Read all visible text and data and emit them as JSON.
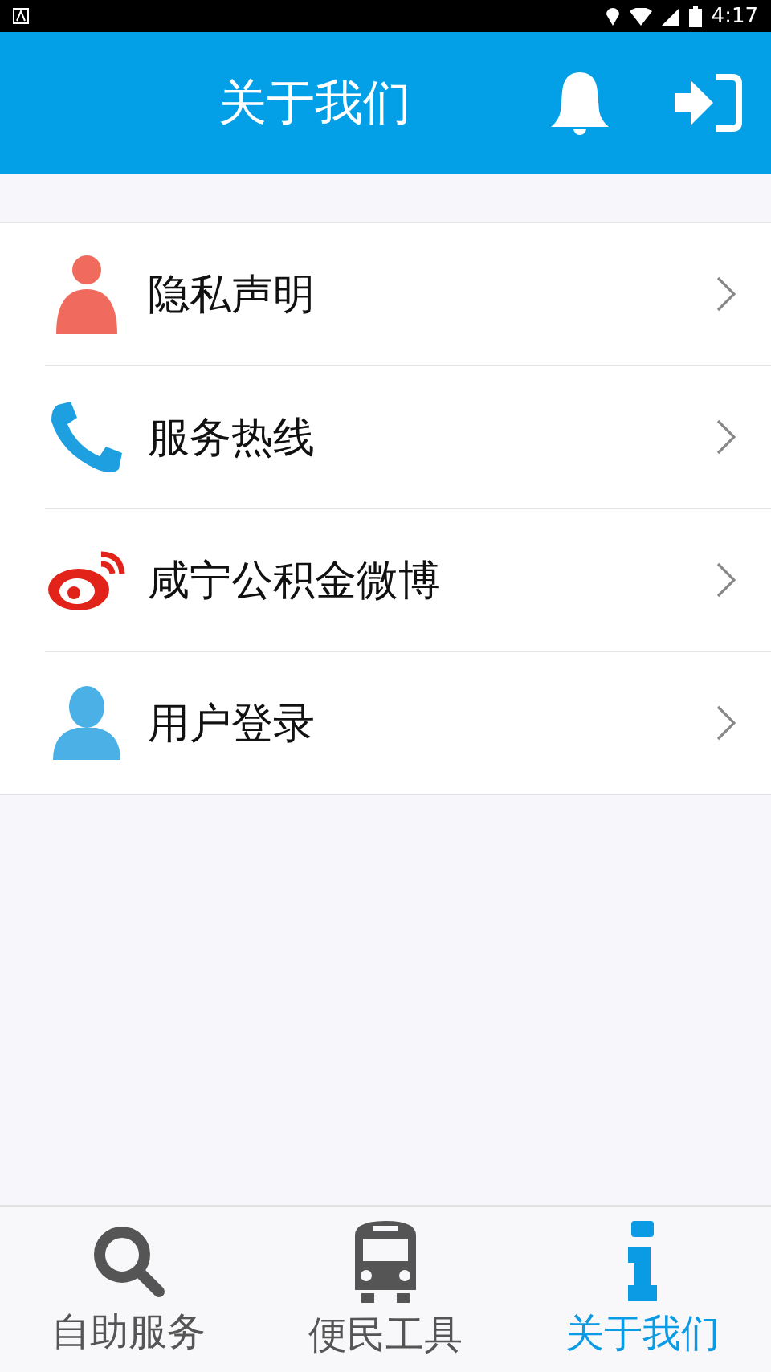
{
  "status_bar": {
    "time": "4:17"
  },
  "header": {
    "title": "关于我们"
  },
  "menu": [
    {
      "label": "隐私声明",
      "kind": "privacy"
    },
    {
      "label": "服务热线",
      "kind": "phone"
    },
    {
      "label": "咸宁公积金微博",
      "kind": "weibo"
    },
    {
      "label": "用户登录",
      "kind": "user"
    }
  ],
  "tabs": [
    {
      "label": "自助服务",
      "kind": "search",
      "selected": false
    },
    {
      "label": "便民工具",
      "kind": "bus",
      "selected": false
    },
    {
      "label": "关于我们",
      "kind": "info",
      "selected": true
    }
  ]
}
